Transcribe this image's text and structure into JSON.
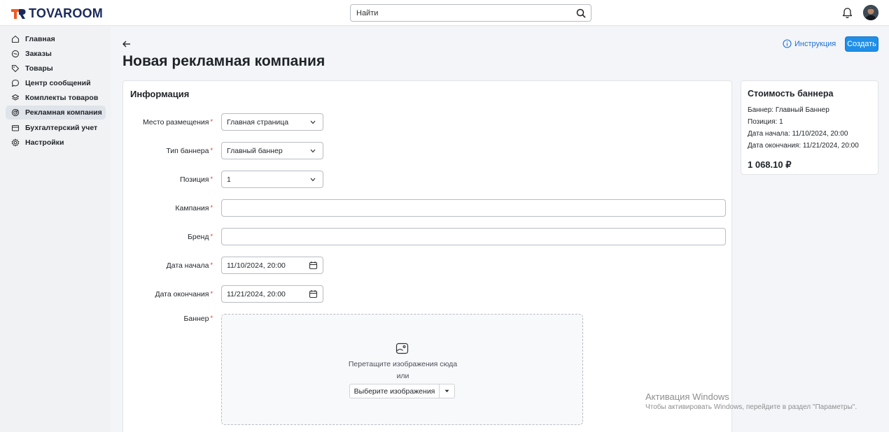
{
  "header": {
    "logo_text": "TOVAROOM",
    "search_placeholder": "Найти"
  },
  "sidebar": {
    "items": [
      {
        "label": "Главная",
        "icon": "home-icon"
      },
      {
        "label": "Заказы",
        "icon": "orders-icon"
      },
      {
        "label": "Товары",
        "icon": "tag-icon"
      },
      {
        "label": "Центр сообщений",
        "icon": "message-icon"
      },
      {
        "label": "Комплекты товаров",
        "icon": "bundle-icon"
      },
      {
        "label": "Рекламная компания",
        "icon": "target-icon",
        "active": true
      },
      {
        "label": "Бухгалтерский учет",
        "icon": "wallet-icon"
      },
      {
        "label": "Настройки",
        "icon": "gear-icon"
      }
    ]
  },
  "page": {
    "title": "Новая рекламная компания",
    "instruction_link": "Инструкция",
    "create_button": "Создать"
  },
  "form": {
    "section_title": "Информация",
    "placement_label": "Место размещения",
    "placement_value": "Главная страница",
    "banner_type_label": "Тип баннера",
    "banner_type_value": "Главный баннер",
    "position_label": "Позиция",
    "position_value": "1",
    "campaign_label": "Кампания",
    "campaign_value": "",
    "brand_label": "Бренд",
    "brand_value": "",
    "start_label": "Дата начала",
    "start_value": "11/10/2024, 20:00",
    "end_label": "Дата окончания",
    "end_value": "11/21/2024, 20:00",
    "banner_label": "Баннер",
    "required_mark": "*",
    "dropzone_text": "Перетащите изображения сюда",
    "dropzone_or": "или",
    "dropzone_button": "Выберите изображения"
  },
  "cost": {
    "title": "Стоимость баннера",
    "banner_line": "Баннер: Главный Баннер",
    "position_line": "Позиция: 1",
    "start_line": "Дата начала: 11/10/2024, 20:00",
    "end_line": "Дата окончания: 11/21/2024, 20:00",
    "price": "1 068.10 ₽"
  },
  "watermark": {
    "title": "Активация Windows",
    "subtitle": "Чтобы активировать Windows, перейдите в раздел \"Параметры\"."
  },
  "colors": {
    "accent": "#1f8fe8",
    "link": "#1e6fd9",
    "logo_orange": "#f05a22",
    "logo_navy": "#1a2a5a",
    "required": "#e0342b"
  }
}
